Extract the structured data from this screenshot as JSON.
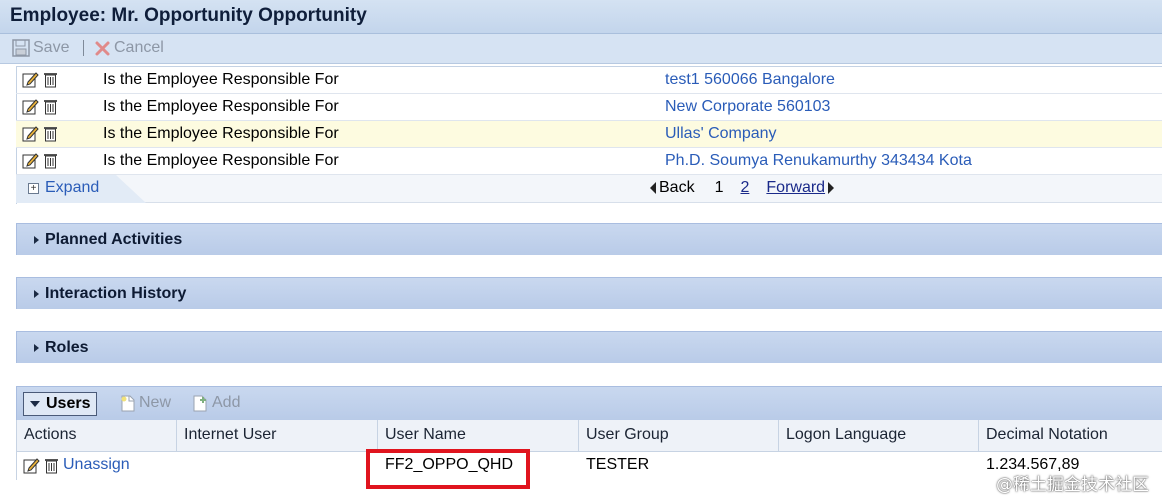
{
  "window": {
    "title": "Employee: Mr. Opportunity Opportunity"
  },
  "toolbar": {
    "save_label": "Save",
    "cancel_label": "Cancel"
  },
  "relationships": [
    {
      "relation": "Is the Employee Responsible For",
      "account": "test1 560066 Bangalore"
    },
    {
      "relation": "Is the Employee Responsible For",
      "account": "New Corporate 560103"
    },
    {
      "relation": "Is the Employee Responsible For",
      "account": "Ullas' Company"
    },
    {
      "relation": "Is the Employee Responsible For",
      "account": "Ph.D. Soumya Renukamurthy 343434 Kota"
    }
  ],
  "expand": {
    "label": "Expand"
  },
  "pager": {
    "back": "Back",
    "page1": "1",
    "page2": "2",
    "forward": "Forward"
  },
  "sections": {
    "planned": "Planned Activities",
    "interaction": "Interaction History",
    "roles": "Roles"
  },
  "users": {
    "title": "Users",
    "new_label": "New",
    "add_label": "Add",
    "columns": [
      "Actions",
      "Internet User",
      "User Name",
      "User Group",
      "Logon Language",
      "Decimal Notation"
    ],
    "row": {
      "action": "Unassign",
      "internet_user": "",
      "user_name": "FF2_OPPO_QHD",
      "user_group": "TESTER",
      "logon_language": "",
      "decimal_notation": "1.234.567,89"
    }
  },
  "watermark": "@稀土掘金技术社区",
  "colors": {
    "link": "#2a5cb8",
    "highlight_row": "#fdfbe0",
    "section_header": "#c9d8ef",
    "highlight_box": "#e0141e"
  }
}
